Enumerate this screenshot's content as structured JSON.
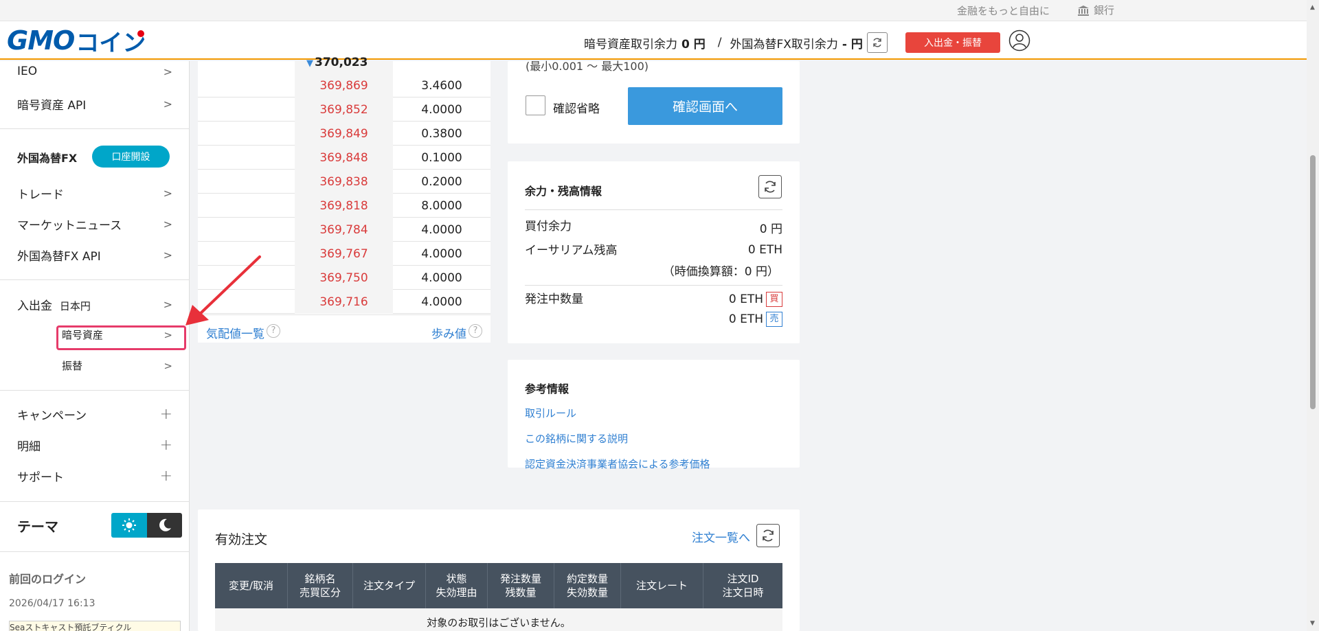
{
  "top": {
    "slogan": "金融をもっと自由に",
    "bank": "銀行"
  },
  "header": {
    "logo_gmo": "GMO",
    "logo_coin": "コイン",
    "crypto_label": "暗号資産取引余力",
    "crypto_value": "0 円",
    "separator": "/",
    "fx_label": "外国為替FX取引余力",
    "fx_value": "- 円",
    "deposit_button": "入出金・振替"
  },
  "sidebar": {
    "ieo": "IEO",
    "crypto_api": "暗号資産 API",
    "fx_title": "外国為替FX",
    "open_account": "口座開設",
    "trade": "トレード",
    "market_news": "マーケットニュース",
    "fx_api": "外国為替FX API",
    "deposit": "入出金",
    "deposit_yen": "日本円",
    "deposit_crypto": "暗号資産",
    "transfer": "振替",
    "campaign": "キャンペーン",
    "statement": "明細",
    "support": "サポート",
    "theme": "テーマ",
    "last_login_label": "前回のログイン",
    "last_login_value": "2026/04/17 16:13",
    "banner_text": "Seaストキャスト預託ブティクル"
  },
  "order_book": {
    "mid_price": "370,023",
    "rows": [
      {
        "price": "369,869",
        "qty": "3.4600"
      },
      {
        "price": "369,852",
        "qty": "4.0000"
      },
      {
        "price": "369,849",
        "qty": "0.3800"
      },
      {
        "price": "369,848",
        "qty": "0.1000"
      },
      {
        "price": "369,838",
        "qty": "0.2000"
      },
      {
        "price": "369,818",
        "qty": "8.0000"
      },
      {
        "price": "369,784",
        "qty": "4.0000"
      },
      {
        "price": "369,767",
        "qty": "4.0000"
      },
      {
        "price": "369,750",
        "qty": "4.0000"
      },
      {
        "price": "369,716",
        "qty": "4.0000"
      }
    ],
    "quote_list": "気配値一覧",
    "tick_history": "歩み値",
    "help": "?"
  },
  "order_form": {
    "range": "(最小0.001 ～ 最大100)",
    "skip_confirm": "確認省略",
    "confirm_button": "確認画面へ"
  },
  "balance": {
    "title": "余力・残高情報",
    "buying_power_label": "買付余力",
    "buying_power_value": "0 円",
    "eth_label": "イーサリアム残高",
    "eth_value": "0 ETH",
    "eth_yen": "（時価換算額：0 円）",
    "pending_label": "発注中数量",
    "pending_buy": "0 ETH",
    "pending_sell": "0 ETH",
    "buy_tag": "買",
    "sell_tag": "売"
  },
  "reference": {
    "title": "参考情報",
    "links": [
      "取引ルール",
      "この銘柄に関する説明",
      "認定資金決済事業者協会による参考価格"
    ]
  },
  "orders": {
    "title": "有効注文",
    "list_link": "注文一覧へ",
    "headers": [
      "変更/取消",
      "銘柄名\n売買区分",
      "注文タイプ",
      "状態\n失効理由",
      "発注数量\n残数量",
      "約定数量\n失効数量",
      "注文レート",
      "注文ID\n注文日時"
    ],
    "empty": "対象のお取引はございません。"
  },
  "colors": {
    "accent": "#f39800",
    "ask": "#d93b3b",
    "link": "#2f7fd1",
    "primary_btn": "#3a99dd",
    "danger": "#e8453c",
    "teal": "#00a6c9"
  }
}
